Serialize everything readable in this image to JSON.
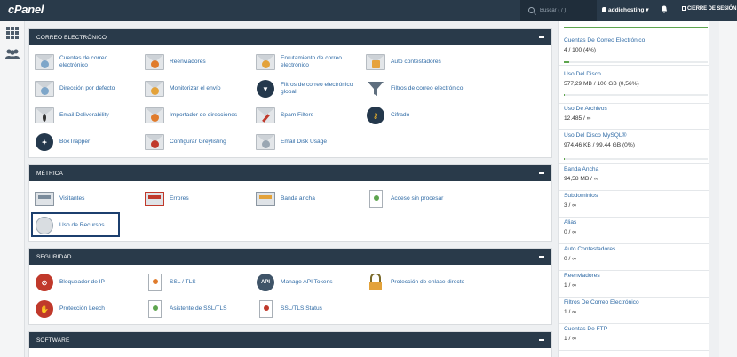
{
  "topbar": {
    "logo": "cPanel",
    "search_placeholder": "Buscar ( / )",
    "user": "addichosting",
    "logout": "CIERRE DE SESIÓN"
  },
  "colors": {
    "topbar": "#293a4a",
    "link": "#2e6aa5",
    "bar": "#5ea54e"
  },
  "email": {
    "title": "CORREO ELECTRÓNICO",
    "items": [
      {
        "label1": "Cuentas de correo",
        "label2": "electrónico",
        "icon": "email-accounts-icon"
      },
      {
        "label1": "Reenviadores",
        "label2": "",
        "icon": "forwarders-icon"
      },
      {
        "label1": "Enrutamiento de correo",
        "label2": "electrónico",
        "icon": "email-routing-icon"
      },
      {
        "label1": "Auto contestadores",
        "label2": "",
        "icon": "autoresponders-icon"
      },
      {
        "label1": "Dirección por defecto",
        "label2": "",
        "icon": "default-address-icon"
      },
      {
        "label1": "Monitorizar el envío",
        "label2": "",
        "icon": "track-delivery-icon"
      },
      {
        "label1": "Filtros de correo electrónico",
        "label2": "global",
        "icon": "global-filters-icon"
      },
      {
        "label1": "Filtros de correo electrónico",
        "label2": "",
        "icon": "email-filters-icon"
      },
      {
        "label1": "Email Deliverability",
        "label2": "",
        "icon": "deliverability-icon"
      },
      {
        "label1": "Importador de direcciones",
        "label2": "",
        "icon": "address-importer-icon"
      },
      {
        "label1": "Spam Filters",
        "label2": "",
        "icon": "spam-filters-icon"
      },
      {
        "label1": "Cifrado",
        "label2": "",
        "icon": "encryption-icon"
      },
      {
        "label1": "BoxTrapper",
        "label2": "",
        "icon": "boxtrapper-icon"
      },
      {
        "label1": "Configurar Greylisting",
        "label2": "",
        "icon": "greylisting-icon"
      },
      {
        "label1": "Email Disk Usage",
        "label2": "",
        "icon": "email-disk-usage-icon"
      }
    ]
  },
  "metrics": {
    "title": "MÉTRICA",
    "items": [
      {
        "label": "Visitantes",
        "icon": "visitors-icon"
      },
      {
        "label": "Errores",
        "icon": "errors-icon"
      },
      {
        "label": "Banda ancha",
        "icon": "bandwidth-icon"
      },
      {
        "label": "Acceso sin procesar",
        "icon": "raw-access-icon"
      },
      {
        "label": "Uso de Recursos",
        "icon": "resource-usage-icon"
      }
    ]
  },
  "security": {
    "title": "SEGURIDAD",
    "items": [
      {
        "label": "Bloqueador de IP",
        "icon": "ip-blocker-icon"
      },
      {
        "label": "SSL / TLS",
        "icon": "ssl-tls-icon"
      },
      {
        "label": "Manage API Tokens",
        "icon": "api-tokens-icon"
      },
      {
        "label": "Protección de enlace directo",
        "icon": "hotlink-protection-icon"
      },
      {
        "label": "Protección Leech",
        "icon": "leech-protection-icon"
      },
      {
        "label": "Asistente de SSL/TLS",
        "icon": "ssl-wizard-icon"
      },
      {
        "label": "SSL/TLS Status",
        "icon": "ssl-status-icon"
      }
    ]
  },
  "software": {
    "title": "SOFTWARE"
  },
  "stats": [
    {
      "title": "Cuentas De Correo Electrónico",
      "value": "4 / 100   (4%)",
      "fraction": 0.04
    },
    {
      "title": "Uso Del Disco",
      "value": "577,29 MB / 100 GB   (0,56%)",
      "fraction": 0.0056
    },
    {
      "title": "Uso De Archivos",
      "value": "12.485 / ∞"
    },
    {
      "title": "Uso Del Disco MySQL®",
      "value": "974,46 KB / 99,44 GB   (0%)",
      "fraction": 0
    },
    {
      "title": "Banda Ancha",
      "value": "94,58 MB / ∞"
    },
    {
      "title": "Subdominios",
      "value": "3 / ∞"
    },
    {
      "title": "Alias",
      "value": "0 / ∞"
    },
    {
      "title": "Auto Contestadores",
      "value": "0 / ∞"
    },
    {
      "title": "Reenviadores",
      "value": "1 / ∞"
    },
    {
      "title": "Filtros De Correo Electrónico",
      "value": "1 / ∞"
    },
    {
      "title": "Cuentas De FTP",
      "value": "1 / ∞"
    }
  ]
}
